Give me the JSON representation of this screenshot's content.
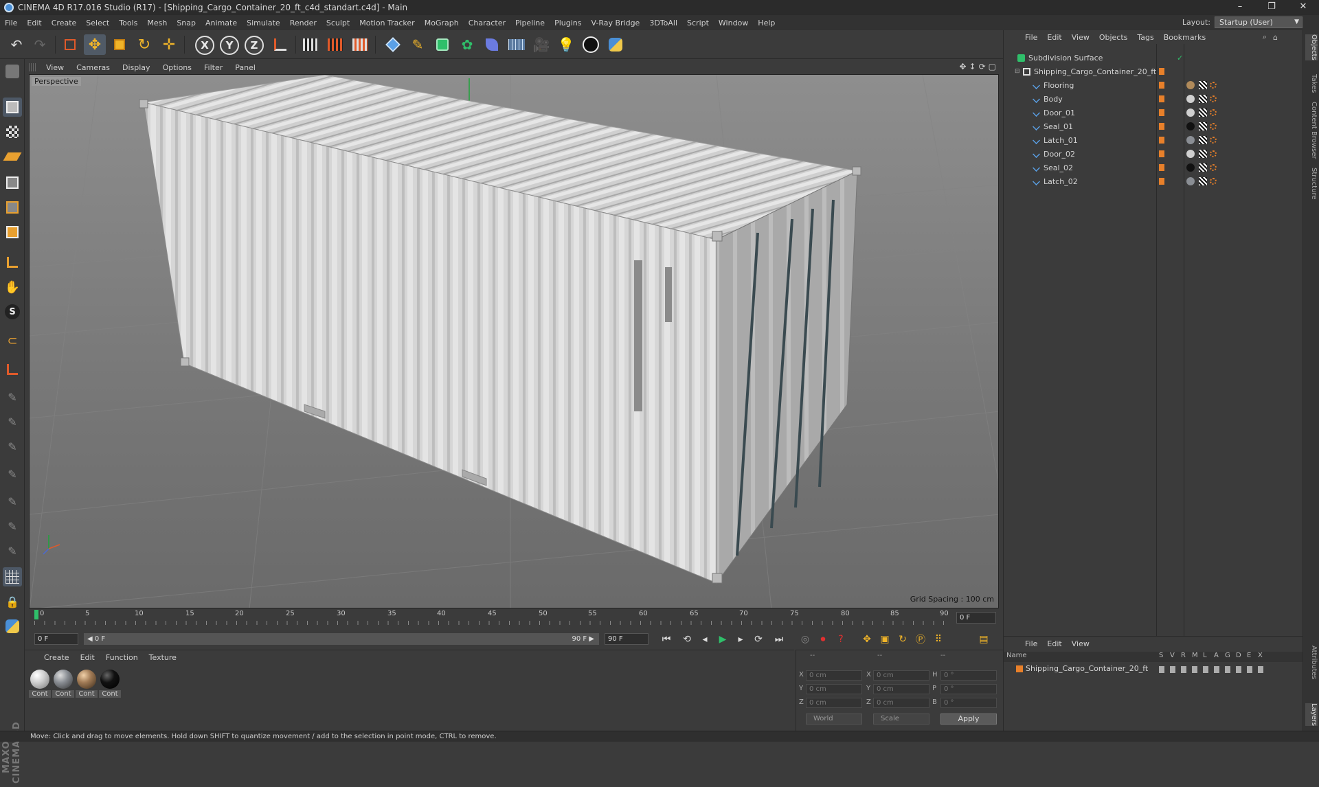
{
  "window": {
    "title": "CINEMA 4D R17.016 Studio (R17) - [Shipping_Cargo_Container_20_ft_c4d_standart.c4d] - Main",
    "minimize": "–",
    "restore": "❐",
    "close": "✕"
  },
  "menubar": {
    "items": [
      "File",
      "Edit",
      "Create",
      "Select",
      "Tools",
      "Mesh",
      "Snap",
      "Animate",
      "Simulate",
      "Render",
      "Sculpt",
      "Motion Tracker",
      "MoGraph",
      "Character",
      "Pipeline",
      "Plugins",
      "V-Ray Bridge",
      "3DToAll",
      "Script",
      "Window",
      "Help"
    ],
    "layout_label": "Layout:",
    "layout_value": "Startup (User)"
  },
  "toolbar": {
    "axis_x": "X",
    "axis_y": "Y",
    "axis_z": "Z"
  },
  "viewport": {
    "menu": [
      "View",
      "Cameras",
      "Display",
      "Options",
      "Filter",
      "Panel"
    ],
    "label": "Perspective",
    "grid_spacing": "Grid Spacing : 100 cm"
  },
  "timeline": {
    "ticks": [
      "0",
      "5",
      "10",
      "15",
      "20",
      "25",
      "30",
      "35",
      "40",
      "45",
      "50",
      "55",
      "60",
      "65",
      "70",
      "75",
      "80",
      "85",
      "90"
    ],
    "current_frame": "0 F"
  },
  "playback": {
    "start_field": "0 F",
    "range_start": "◀ 0 F",
    "range_end": "90 F ▶",
    "end_field": "90 F"
  },
  "materials": {
    "menu": [
      "Create",
      "Edit",
      "Function",
      "Texture"
    ],
    "items": [
      {
        "label": "Cont",
        "color": "#cfcfcf"
      },
      {
        "label": "Cont",
        "color": "#8a8e94"
      },
      {
        "label": "Cont",
        "color": "#a07a55"
      },
      {
        "label": "Cont",
        "color": "#111111"
      }
    ]
  },
  "coordinates": {
    "header": [
      "--",
      "--",
      "--"
    ],
    "rows": [
      {
        "l1": "X",
        "v1": "0 cm",
        "l2": "X",
        "v2": "0 cm",
        "l3": "H",
        "v3": "0 °"
      },
      {
        "l1": "Y",
        "v1": "0 cm",
        "l2": "Y",
        "v2": "0 cm",
        "l3": "P",
        "v3": "0 °"
      },
      {
        "l1": "Z",
        "v1": "0 cm",
        "l2": "Z",
        "v2": "0 cm",
        "l3": "B",
        "v3": "0 °"
      }
    ],
    "mode": "World",
    "scale": "Scale",
    "apply": "Apply"
  },
  "objects": {
    "menu": [
      "File",
      "Edit",
      "View",
      "Objects",
      "Tags",
      "Bookmarks"
    ],
    "tree": [
      {
        "name": "Subdivision Surface",
        "level": 0
      },
      {
        "name": "Shipping_Cargo_Container_20_ft",
        "level": 1
      },
      {
        "name": "Flooring",
        "level": 2,
        "tag_color": "#b08a5a"
      },
      {
        "name": "Body",
        "level": 2,
        "tag_color": "#d0d0d0"
      },
      {
        "name": "Door_01",
        "level": 2,
        "tag_color": "#d0d0d0"
      },
      {
        "name": "Seal_01",
        "level": 2,
        "tag_color": "#111111"
      },
      {
        "name": "Latch_01",
        "level": 2,
        "tag_color": "#8a8e94"
      },
      {
        "name": "Door_02",
        "level": 2,
        "tag_color": "#d0d0d0"
      },
      {
        "name": "Seal_02",
        "level": 2,
        "tag_color": "#111111"
      },
      {
        "name": "Latch_02",
        "level": 2,
        "tag_color": "#8a8e94"
      }
    ]
  },
  "attributes": {
    "menu": [
      "File",
      "Edit",
      "View"
    ],
    "columns": [
      "Name",
      "S",
      "V",
      "R",
      "M",
      "L",
      "A",
      "G",
      "D",
      "E",
      "X"
    ],
    "row": "Shipping_Cargo_Container_20_ft"
  },
  "right_tabs": [
    "Objects",
    "Takes",
    "Content Browser",
    "Structure",
    "Attributes",
    "Layers"
  ],
  "status": "Move: Click and drag to move elements. Hold down SHIFT to quantize movement / add to the selection in point mode, CTRL to remove."
}
